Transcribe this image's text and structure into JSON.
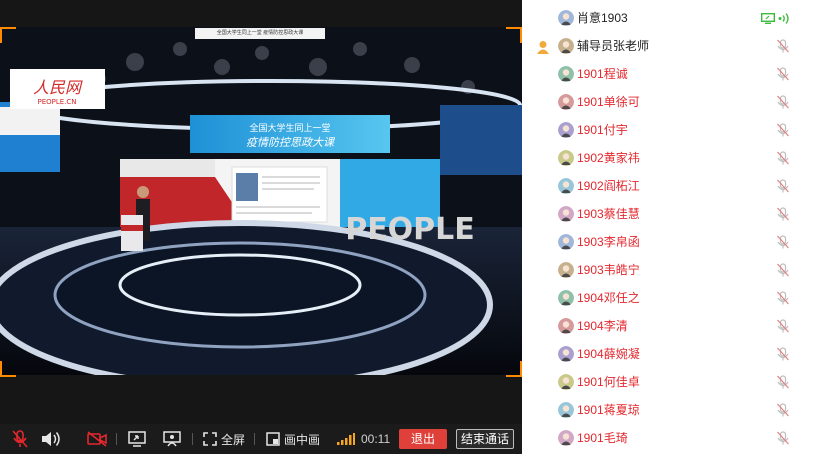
{
  "video": {
    "caption": "全国大学生同上一堂 疫情防控思政大课",
    "brand_logo": "人民网",
    "brand_logo_sub": "PEOPLE.CN",
    "stage_sign": "PEOPLE",
    "banner_line1": "全国大学生同上一堂",
    "banner_line2": "疫情防控思政大课"
  },
  "controls": {
    "fullscreen_label": "全屏",
    "pip_label": "画中画",
    "timer": "00:11",
    "exit_label": "退出",
    "end_call_label": "结束通话"
  },
  "colors": {
    "accent_orange": "#ff8a00",
    "exit_red": "#e0403a",
    "student_red": "#e3282e",
    "host_black": "#222222",
    "active_green": "#3dbb3d"
  },
  "participants": [
    {
      "name": "肖意1903",
      "role": "host",
      "status": "active"
    },
    {
      "name": "辅导员张老师",
      "role": "teacher",
      "status": "muted"
    },
    {
      "name": "1901程诚",
      "role": "student",
      "status": "muted"
    },
    {
      "name": "1901单徐可",
      "role": "student",
      "status": "muted"
    },
    {
      "name": "1901付宇",
      "role": "student",
      "status": "muted"
    },
    {
      "name": "1902黄家祎",
      "role": "student",
      "status": "muted"
    },
    {
      "name": "1902阎柘江",
      "role": "student",
      "status": "muted"
    },
    {
      "name": "1903蔡佳慧",
      "role": "student",
      "status": "muted"
    },
    {
      "name": "1903李帛函",
      "role": "student",
      "status": "muted"
    },
    {
      "name": "1903韦皓宁",
      "role": "student",
      "status": "muted"
    },
    {
      "name": "1904邓任之",
      "role": "student",
      "status": "muted"
    },
    {
      "name": "1904李清",
      "role": "student",
      "status": "muted"
    },
    {
      "name": "1904薛婉凝",
      "role": "student",
      "status": "muted"
    },
    {
      "name": "1901何佳卓",
      "role": "student",
      "status": "muted"
    },
    {
      "name": "1901蒋夏琼",
      "role": "student",
      "status": "muted"
    },
    {
      "name": "1901毛琦",
      "role": "student",
      "status": "muted"
    }
  ]
}
